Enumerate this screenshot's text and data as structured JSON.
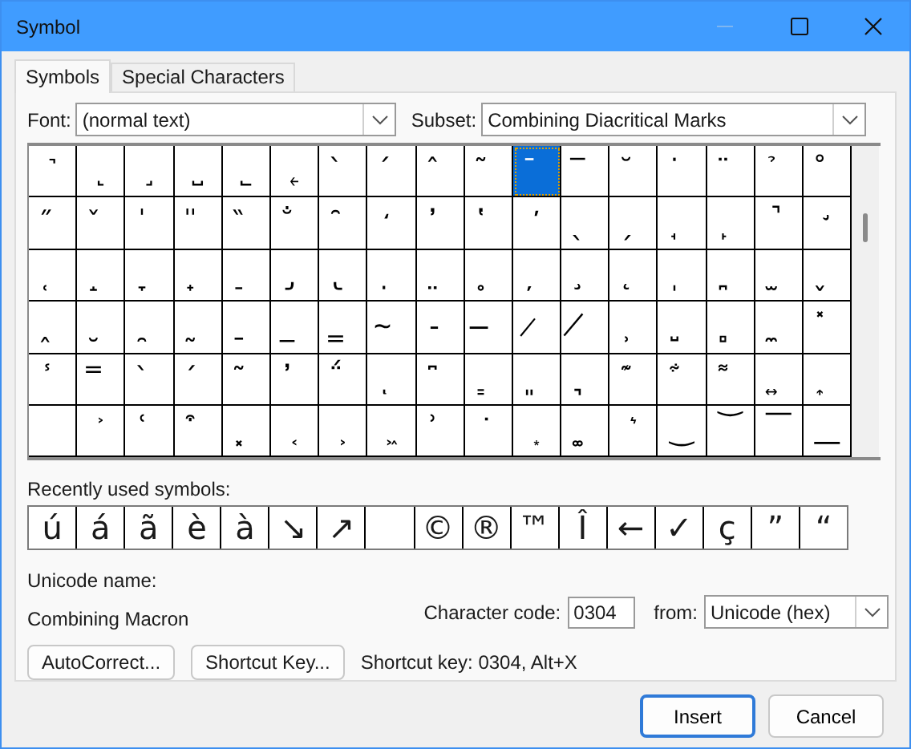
{
  "window": {
    "title": "Symbol",
    "minimize_disabled": true
  },
  "tabs": [
    {
      "label": "Symbols",
      "selected": true
    },
    {
      "label": "Special Characters",
      "selected": false
    }
  ],
  "font": {
    "label": "Font:",
    "value": "(normal text)"
  },
  "subset": {
    "label": "Subset:",
    "value": "Combining Diacritical Marks"
  },
  "grid": {
    "rows": [
      [
        {
          "char": "˺",
          "selected": false
        },
        {
          "char": "˻",
          "selected": false
        },
        {
          "char": "˼",
          "selected": false
        },
        {
          "char": "˽",
          "selected": false
        },
        {
          "char": "˾",
          "selected": false
        },
        {
          "char": "˿",
          "selected": false
        },
        {
          "char": "̀",
          "selected": false
        },
        {
          "char": "́",
          "selected": false
        },
        {
          "char": "̂",
          "selected": false
        },
        {
          "char": "̃",
          "selected": false
        },
        {
          "char": "̄",
          "selected": true
        },
        {
          "char": "̅",
          "selected": false
        },
        {
          "char": "̆",
          "selected": false
        },
        {
          "char": "̇",
          "selected": false
        },
        {
          "char": "̈",
          "selected": false
        },
        {
          "char": "̉",
          "selected": false
        },
        {
          "char": "̊",
          "selected": false
        }
      ],
      [
        {
          "char": "̋",
          "selected": false
        },
        {
          "char": "̌",
          "selected": false
        },
        {
          "char": "̍",
          "selected": false
        },
        {
          "char": "̎",
          "selected": false
        },
        {
          "char": "̏",
          "selected": false
        },
        {
          "char": "̐",
          "selected": false
        },
        {
          "char": "̑",
          "selected": false
        },
        {
          "char": "̒",
          "selected": false
        },
        {
          "char": "̓",
          "selected": false
        },
        {
          "char": "̔",
          "selected": false
        },
        {
          "char": "̕",
          "selected": false
        },
        {
          "char": "̖",
          "selected": false
        },
        {
          "char": "̗",
          "selected": false
        },
        {
          "char": "̘",
          "selected": false
        },
        {
          "char": "̙",
          "selected": false
        },
        {
          "char": "̚",
          "selected": false
        },
        {
          "char": "̛",
          "selected": false
        }
      ],
      [
        {
          "char": "̜",
          "selected": false
        },
        {
          "char": "̝",
          "selected": false
        },
        {
          "char": "̞",
          "selected": false
        },
        {
          "char": "̟",
          "selected": false
        },
        {
          "char": "̠",
          "selected": false
        },
        {
          "char": "̡",
          "selected": false
        },
        {
          "char": "̢",
          "selected": false
        },
        {
          "char": "̣",
          "selected": false
        },
        {
          "char": "̤",
          "selected": false
        },
        {
          "char": "̥",
          "selected": false
        },
        {
          "char": "̦",
          "selected": false
        },
        {
          "char": "̧",
          "selected": false
        },
        {
          "char": "̨",
          "selected": false
        },
        {
          "char": "̩",
          "selected": false
        },
        {
          "char": "̪",
          "selected": false
        },
        {
          "char": "̫",
          "selected": false
        },
        {
          "char": "̬",
          "selected": false
        }
      ],
      [
        {
          "char": "̭",
          "selected": false
        },
        {
          "char": "̮",
          "selected": false
        },
        {
          "char": "̯",
          "selected": false
        },
        {
          "char": "̰",
          "selected": false
        },
        {
          "char": "̱",
          "selected": false
        },
        {
          "char": "̲",
          "selected": false
        },
        {
          "char": "̳",
          "selected": false
        },
        {
          "char": "̴",
          "selected": false
        },
        {
          "char": "̵",
          "selected": false
        },
        {
          "char": "̶",
          "selected": false
        },
        {
          "char": "̷",
          "selected": false
        },
        {
          "char": "̸",
          "selected": false
        },
        {
          "char": "̹",
          "selected": false
        },
        {
          "char": "̺",
          "selected": false
        },
        {
          "char": "̻",
          "selected": false
        },
        {
          "char": "̼",
          "selected": false
        },
        {
          "char": "̽",
          "selected": false
        }
      ],
      [
        {
          "char": "̾",
          "selected": false
        },
        {
          "char": "̿",
          "selected": false
        },
        {
          "char": "̀",
          "selected": false
        },
        {
          "char": "́",
          "selected": false
        },
        {
          "char": "͂",
          "selected": false
        },
        {
          "char": "̓",
          "selected": false
        },
        {
          "char": "̈́",
          "selected": false
        },
        {
          "char": "ͅ",
          "selected": false
        },
        {
          "char": "͆",
          "selected": false
        },
        {
          "char": "͇",
          "selected": false
        },
        {
          "char": "͈",
          "selected": false
        },
        {
          "char": "͉",
          "selected": false
        },
        {
          "char": "͊",
          "selected": false
        },
        {
          "char": "͋",
          "selected": false
        },
        {
          "char": "͌",
          "selected": false
        },
        {
          "char": "͍",
          "selected": false
        },
        {
          "char": "͎",
          "selected": false
        }
      ],
      [
        {
          "selected": false
        },
        {
          "char": "͐",
          "selected": false
        },
        {
          "char": "͑",
          "selected": false
        },
        {
          "char": "͒",
          "selected": false
        },
        {
          "char": "͓",
          "selected": false
        },
        {
          "char": "͔",
          "selected": false
        },
        {
          "char": "͕",
          "selected": false
        },
        {
          "char": "͖",
          "selected": false
        },
        {
          "char": "͗",
          "selected": false
        },
        {
          "char": "͘",
          "selected": false
        },
        {
          "char": "͙",
          "selected": false
        },
        {
          "char": "͚",
          "selected": false
        },
        {
          "char": "͛",
          "selected": false
        },
        {
          "char": "͜",
          "selected": false
        },
        {
          "char": "͝",
          "selected": false
        },
        {
          "char": "͞",
          "selected": false
        },
        {
          "char": "͟",
          "selected": false
        }
      ]
    ]
  },
  "recent": {
    "label": "Recently used symbols:",
    "symbols": [
      {
        "kind": "glyph",
        "char": "ú"
      },
      {
        "kind": "glyph",
        "char": "á"
      },
      {
        "kind": "glyph",
        "char": "ã"
      },
      {
        "kind": "glyph",
        "char": "è"
      },
      {
        "kind": "glyph",
        "char": "à"
      },
      {
        "kind": "glyph",
        "char": "↘"
      },
      {
        "kind": "glyph",
        "char": "↗"
      },
      {
        "kind": "blank"
      },
      {
        "kind": "glyph",
        "char": "©"
      },
      {
        "kind": "glyph",
        "char": "®"
      },
      {
        "kind": "glyph",
        "char": "™"
      },
      {
        "kind": "glyph",
        "char": "Î"
      },
      {
        "kind": "glyph",
        "char": "←"
      },
      {
        "kind": "glyph",
        "char": "✓"
      },
      {
        "kind": "glyph",
        "char": "ç"
      },
      {
        "kind": "glyph",
        "char": "”"
      },
      {
        "kind": "glyph",
        "char": "“"
      }
    ]
  },
  "unicode_name": {
    "label": "Unicode name:",
    "value": "Combining Macron"
  },
  "character_code": {
    "label": "Character code:",
    "value": "0304"
  },
  "from": {
    "label": "from:",
    "value": "Unicode (hex)"
  },
  "autocorrect_button": "AutoCorrect...",
  "shortcut_key_button": "Shortcut Key...",
  "shortcut_key_text": "Shortcut key: 0304, Alt+X",
  "buttons": [
    {
      "label": "Insert",
      "default": true
    },
    {
      "label": "Cancel",
      "default": false
    }
  ]
}
